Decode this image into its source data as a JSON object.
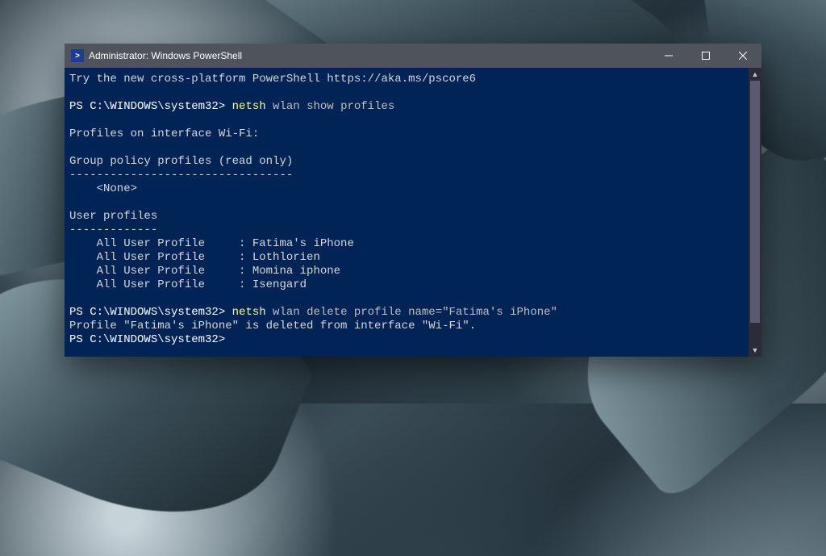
{
  "window": {
    "title": "Administrator: Windows PowerShell",
    "icon_glyph": ">"
  },
  "terminal": {
    "banner": "Try the new cross-platform PowerShell https://aka.ms/pscore6",
    "prompt": "PS C:\\WINDOWS\\system32>",
    "cmd1_exe": "netsh",
    "cmd1_rest": " wlan show profiles",
    "profiles_header": "Profiles on interface Wi-Fi:",
    "group_header": "Group policy profiles (read only)",
    "group_dash": "---------------------------------",
    "group_none": "    <None>",
    "user_header": "User profiles",
    "user_dash": "-------------",
    "user_profiles": [
      "    All User Profile     : Fatima's iPhone",
      "    All User Profile     : Lothlorien",
      "    All User Profile     : Momina iphone",
      "    All User Profile     : Isengard"
    ],
    "cmd2_exe": "netsh",
    "cmd2_rest": " wlan delete profile name=\"Fatima's iPhone\"",
    "delete_result": "Profile \"Fatima's iPhone\" is deleted from interface \"Wi-Fi\"."
  }
}
